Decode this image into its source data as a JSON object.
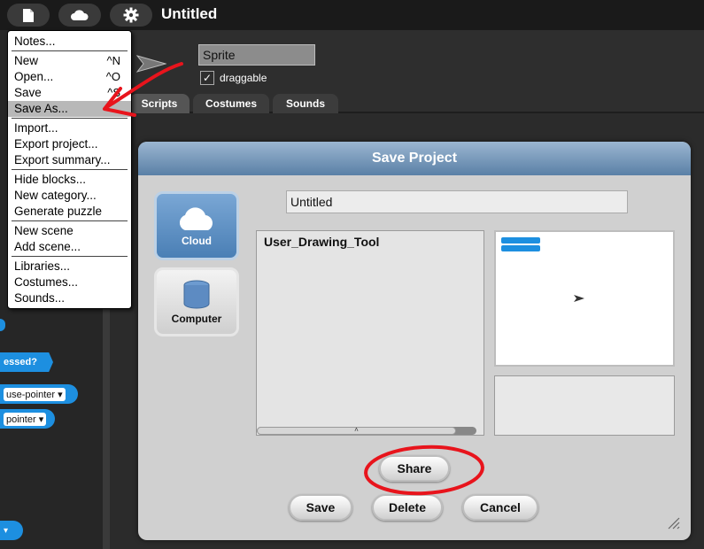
{
  "topbar": {
    "title": "Untitled",
    "file_icon": "file-icon",
    "cloud_icon": "cloud-icon",
    "settings_icon": "gear-icon"
  },
  "sprite": {
    "name": "Sprite",
    "draggable_check": "✓",
    "draggable_label": "draggable"
  },
  "tabs": [
    "Scripts",
    "Costumes",
    "Sounds"
  ],
  "palette": {
    "pressed_label": "essed?",
    "mouse_pointer_a": "use-pointer",
    "mouse_pointer_b": "pointer"
  },
  "file_menu": {
    "items": [
      {
        "label": "Notes...",
        "shortcut": ""
      },
      {
        "label": "New",
        "shortcut": "^N"
      },
      {
        "label": "Open...",
        "shortcut": "^O"
      },
      {
        "label": "Save",
        "shortcut": "^S"
      },
      {
        "label": "Save As...",
        "shortcut": ""
      },
      {
        "label": "Import...",
        "shortcut": ""
      },
      {
        "label": "Export project...",
        "shortcut": ""
      },
      {
        "label": "Export summary...",
        "shortcut": ""
      },
      {
        "label": "Hide blocks...",
        "shortcut": ""
      },
      {
        "label": "New category...",
        "shortcut": ""
      },
      {
        "label": "Generate puzzle",
        "shortcut": ""
      },
      {
        "label": "New scene",
        "shortcut": ""
      },
      {
        "label": "Add scene...",
        "shortcut": ""
      },
      {
        "label": "Libraries...",
        "shortcut": ""
      },
      {
        "label": "Costumes...",
        "shortcut": ""
      },
      {
        "label": "Sounds...",
        "shortcut": ""
      }
    ],
    "highlighted": "Save As..."
  },
  "dialog": {
    "title": "Save Project",
    "sources": [
      {
        "label": "Cloud",
        "icon": "cloud-icon",
        "selected": true
      },
      {
        "label": "Computer",
        "icon": "database-icon",
        "selected": false
      }
    ],
    "project_name": "Untitled",
    "projects": [
      "User_Drawing_Tool"
    ],
    "buttons": {
      "share": "Share",
      "save": "Save",
      "delete": "Delete",
      "cancel": "Cancel"
    }
  },
  "annotation_color": "#e8141c",
  "accent_blue": "#4a7fb5"
}
